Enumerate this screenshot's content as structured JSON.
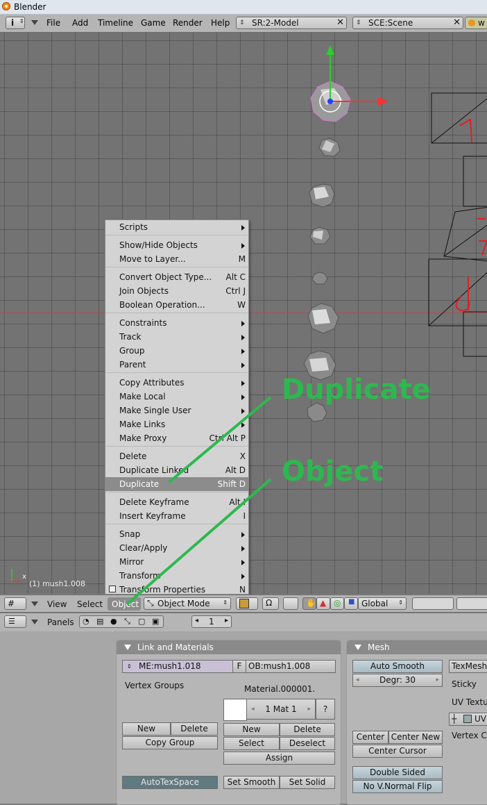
{
  "window": {
    "title": "Blender"
  },
  "topbar": {
    "menus": [
      "File",
      "Add",
      "Timeline",
      "Game",
      "Render",
      "Help"
    ],
    "screen_field": "SR:2-Model",
    "scene_field": "SCE:Scene",
    "right_field_partial": "w"
  },
  "viewport": {
    "active_object_label": "(1) mush1.008",
    "axis_x_label": "x",
    "grid_color": "#737373",
    "axis_colors": {
      "x": "#ff3030",
      "y": "#2ecc2e",
      "z": "#2040ff"
    }
  },
  "object_menu": {
    "items": [
      {
        "label": "Scripts",
        "submenu": true
      },
      {
        "sep": true
      },
      {
        "label": "Show/Hide Objects",
        "submenu": true
      },
      {
        "label": "Move to Layer...",
        "shortcut": "M"
      },
      {
        "sep": true
      },
      {
        "label": "Convert Object Type...",
        "shortcut": "Alt C"
      },
      {
        "label": "Join Objects",
        "shortcut": "Ctrl J"
      },
      {
        "label": "Boolean Operation...",
        "shortcut": "W"
      },
      {
        "sep": true
      },
      {
        "label": "Constraints",
        "submenu": true
      },
      {
        "label": "Track",
        "submenu": true
      },
      {
        "label": "Group",
        "submenu": true
      },
      {
        "label": "Parent",
        "submenu": true
      },
      {
        "sep": true
      },
      {
        "label": "Copy Attributes",
        "submenu": true
      },
      {
        "label": "Make Local",
        "submenu": true
      },
      {
        "label": "Make Single User",
        "submenu": true
      },
      {
        "label": "Make Links",
        "submenu": true
      },
      {
        "label": "Make Proxy",
        "shortcut": "Ctrl Alt P"
      },
      {
        "sep": true
      },
      {
        "label": "Delete",
        "shortcut": "X"
      },
      {
        "label": "Duplicate Linked",
        "shortcut": "Alt D"
      },
      {
        "label": "Duplicate",
        "shortcut": "Shift D",
        "highlighted": true
      },
      {
        "sep": true
      },
      {
        "label": "Delete Keyframe",
        "shortcut": "Alt I"
      },
      {
        "label": "Insert Keyframe",
        "shortcut": "I"
      },
      {
        "sep": true
      },
      {
        "label": "Snap",
        "submenu": true
      },
      {
        "label": "Clear/Apply",
        "submenu": true
      },
      {
        "label": "Mirror",
        "submenu": true
      },
      {
        "label": "Transform",
        "submenu": true
      },
      {
        "label": "Transform Properties",
        "shortcut": "N",
        "checkbox": true
      }
    ]
  },
  "view_header": {
    "view": "View",
    "select": "Select",
    "object": "Object",
    "mode": "Object Mode",
    "orientation": "Global"
  },
  "buttons_header": {
    "panels_label": "Panels",
    "frame_value": "1"
  },
  "link_materials": {
    "title": "Link and Materials",
    "mesh_field": "ME:mush1.018",
    "f_button": "F",
    "object_field": "OB:mush1.008",
    "vertex_groups_label": "Vertex Groups",
    "material_label": "Material.000001.",
    "mat_index": "1 Mat 1",
    "question": "?",
    "vg_new": "New",
    "vg_delete": "Delete",
    "copy_group": "Copy Group",
    "mat_new": "New",
    "mat_delete": "Delete",
    "mat_select": "Select",
    "mat_deselect": "Deselect",
    "assign": "Assign",
    "autotexspace": "AutoTexSpace",
    "set_smooth": "Set Smooth",
    "set_solid": "Set Solid"
  },
  "mesh": {
    "title": "Mesh",
    "auto_smooth": "Auto Smooth",
    "degr": "Degr: 30",
    "texmesh": "TexMesh",
    "sticky": "Sticky",
    "uv_texture": "UV Textu",
    "uv_small": "UV",
    "vertex_colors": "Vertex Co",
    "center": "Center",
    "center_new": "Center New",
    "center_cursor": "Center Cursor",
    "double_sided": "Double Sided",
    "no_vnormal_flip": "No V.Normal Flip"
  },
  "annotations": {
    "duplicate": "Duplicate",
    "object": "Object",
    "color": "#2db84f"
  }
}
